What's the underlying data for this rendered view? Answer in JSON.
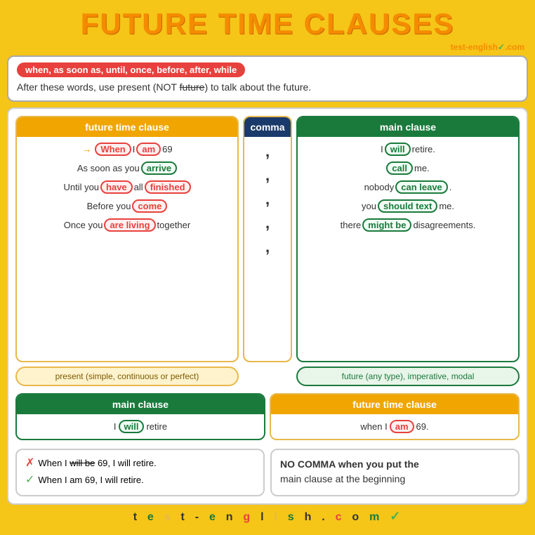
{
  "title": "FUTURE TIME CLAUSES",
  "website": "test-english",
  "domain": ".com",
  "intro": {
    "keywords": "when, as soon as, until, once, before, after, while",
    "text": "After these words, use present (NOT future) to talk about the future."
  },
  "table": {
    "headers": {
      "future": "future time clause",
      "comma": "comma",
      "main": "main clause"
    },
    "rows": [
      {
        "future": "When I am 69",
        "future_pill": "When",
        "future_pill_type": "orange",
        "future_rest": "I",
        "future_num": "69",
        "future_am_pill": "am",
        "comma": ",",
        "main": "I will retire.",
        "main_pill": "will",
        "main_pill_type": "green"
      },
      {
        "future": "As soon as you arrive",
        "future_pill": "arrive",
        "future_pill_type": "green",
        "comma": ",",
        "main": "call me.",
        "main_pill": "call",
        "main_pill_type": "green"
      },
      {
        "future": "Until you have all finished",
        "future_pill1": "have",
        "future_pill2": "finished",
        "future_pill_type": "orange",
        "comma": ",",
        "main": "nobody can leave.",
        "main_pill": "can leave",
        "main_pill_type": "green"
      },
      {
        "future": "Before you come",
        "future_pill": "come",
        "future_pill_type": "orange",
        "comma": ",",
        "main": "you should text me.",
        "main_pill": "should text",
        "main_pill_type": "green"
      },
      {
        "future": "Once you are living together",
        "future_pill": "are living",
        "future_pill_type": "orange",
        "comma": ",",
        "main": "there might be disagreements.",
        "main_pill": "might be",
        "main_pill_type": "green"
      }
    ],
    "labels": {
      "present": "present (simple, continuous or perfect)",
      "future_modal": "future (any type), imperative, modal"
    }
  },
  "reverse": {
    "headers": {
      "main": "main clause",
      "future": "future time clause"
    },
    "row": {
      "main_text": "I",
      "main_pill": "will",
      "main_rest": "retire",
      "future_text": "when I",
      "future_pill": "am",
      "future_num": "69."
    }
  },
  "errors": {
    "wrong": "When I will be 69, I will retire.",
    "wrong_strike": "will be",
    "correct": "When I am 69, I will retire."
  },
  "no_comma": {
    "line1": "NO COMMA when you put the",
    "line2": "main clause at the beginning"
  },
  "footer": "t e s t - e n g l i s h . c o m"
}
